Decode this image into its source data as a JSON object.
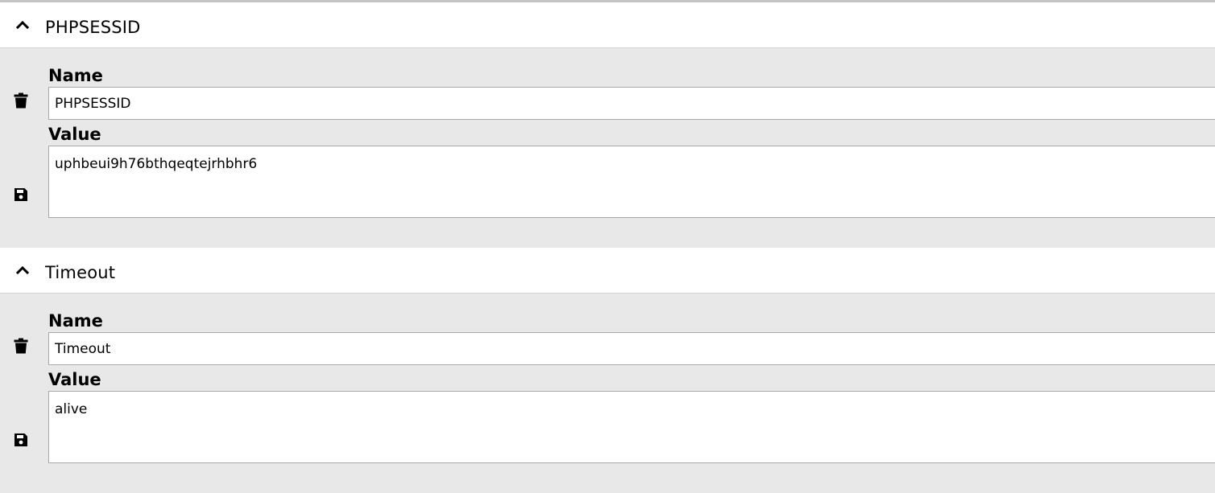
{
  "cookies": [
    {
      "title": "PHPSESSID",
      "name_label": "Name",
      "name_value": "PHPSESSID",
      "value_label": "Value",
      "value_value": "uphbeui9h76bthqeqtejrhbhr6"
    },
    {
      "title": "Timeout",
      "name_label": "Name",
      "name_value": "Timeout",
      "value_label": "Value",
      "value_value": "alive"
    }
  ],
  "icons": {
    "collapse": "chevron-up-icon",
    "delete": "trash-icon",
    "save": "floppy-disk-icon"
  }
}
